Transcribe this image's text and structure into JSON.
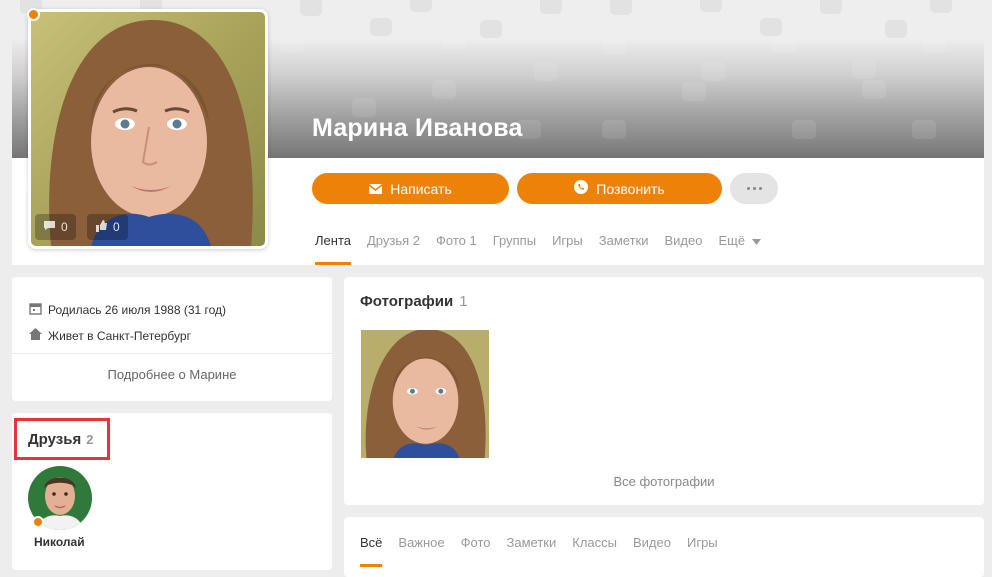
{
  "profile": {
    "name": "Марина Иванова",
    "avatar_comments": "0",
    "avatar_likes": "0",
    "online": true
  },
  "actions": {
    "write_label": "Написать",
    "call_label": "Позвонить",
    "more_label": "···"
  },
  "tabs": [
    {
      "label": "Лента",
      "count": ""
    },
    {
      "label": "Друзья",
      "count": "2"
    },
    {
      "label": "Фото",
      "count": "1"
    },
    {
      "label": "Группы",
      "count": ""
    },
    {
      "label": "Игры",
      "count": ""
    },
    {
      "label": "Заметки",
      "count": ""
    },
    {
      "label": "Видео",
      "count": ""
    },
    {
      "label": "Ещё",
      "count": ""
    }
  ],
  "about": {
    "birthday": "Родилась 26 июля 1988 (31 год)",
    "city": "Живет в Санкт-Петербург",
    "more_link": "Подробнее о Марине"
  },
  "friends": {
    "title": "Друзья",
    "count": "2",
    "items": [
      {
        "name": "Николай"
      }
    ]
  },
  "photos": {
    "title": "Фотографии",
    "count": "1",
    "all_link": "Все фотографии"
  },
  "feed_tabs": [
    "Всё",
    "Важное",
    "Фото",
    "Заметки",
    "Классы",
    "Видео",
    "Игры"
  ],
  "colors": {
    "accent": "#ee8208",
    "highlight_box": "#e8333a",
    "background": "#ededed"
  }
}
